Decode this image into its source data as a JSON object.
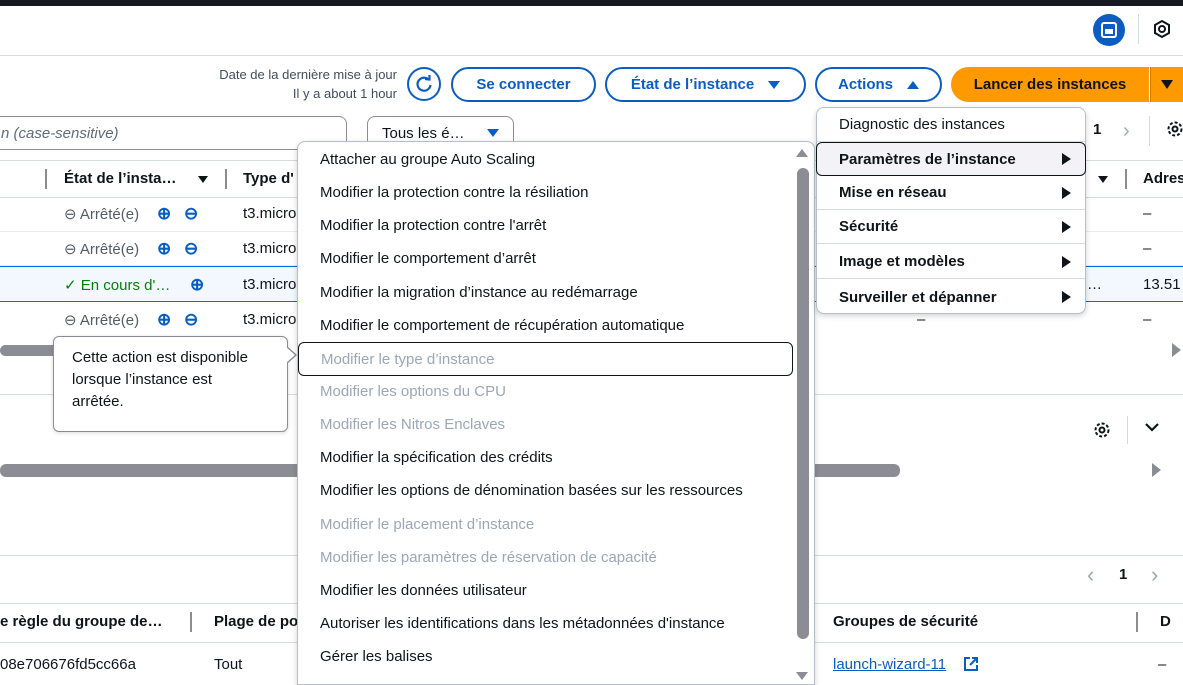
{
  "header": {
    "last_update_label": "Date de la dernière mise à jour",
    "last_update_value": "Il y a about 1 hour",
    "connect_button": "Se connecter",
    "instance_state_button": "État de l’instance",
    "actions_button": "Actions",
    "launch_button": "Lancer des instances"
  },
  "filter": {
    "search_placeholder_fragment": "n (case-sensitive)",
    "state_filter": "Tous les é…",
    "page_number": "1"
  },
  "table": {
    "headers": {
      "state": "État de l’insta…",
      "type": "Type d'",
      "address": "Adres"
    },
    "rows": [
      {
        "state": "Arrêté(e)",
        "type": "t3.micro",
        "address": "–",
        "extra": ""
      },
      {
        "state": "Arrêté(e)",
        "type": "t3.micro",
        "address": "–",
        "extra": ""
      },
      {
        "state": "En cours d'…",
        "type": "t3.micro",
        "address": "13.51",
        "extra": "…"
      },
      {
        "state": "Arrêté(e)",
        "type": "t3.micro",
        "address": "–",
        "extra": "–"
      }
    ]
  },
  "tooltip": {
    "text_line1": "Cette action est disponible",
    "text_line2": "lorsque l’instance est",
    "text_line3": "arrêtée."
  },
  "actions_menu": {
    "items": [
      {
        "label": "Diagnostic des instances",
        "submenu": false
      },
      {
        "label": "Paramètres de l’instance",
        "submenu": true
      },
      {
        "label": "Mise en réseau",
        "submenu": true
      },
      {
        "label": "Sécurité",
        "submenu": true
      },
      {
        "label": "Image et modèles",
        "submenu": true
      },
      {
        "label": "Surveiller et dépanner",
        "submenu": true
      }
    ]
  },
  "submenu": {
    "items": [
      {
        "label": "Attacher au groupe Auto Scaling",
        "disabled": false
      },
      {
        "label": "Modifier la protection contre la résiliation",
        "disabled": false
      },
      {
        "label": "Modifier la protection contre l'arrêt",
        "disabled": false
      },
      {
        "label": "Modifier le comportement d’arrêt",
        "disabled": false
      },
      {
        "label": "Modifier la migration d’instance au redémarrage",
        "disabled": false
      },
      {
        "label": "Modifier le comportement de récupération automatique",
        "disabled": false
      },
      {
        "label": "Modifier le type d’instance",
        "disabled": true
      },
      {
        "label": "Modifier les options du CPU",
        "disabled": true
      },
      {
        "label": "Modifier les Nitros Enclaves",
        "disabled": true
      },
      {
        "label": "Modifier la spécification des crédits",
        "disabled": false
      },
      {
        "label": "Modifier les options de dénomination basées sur les ressources",
        "disabled": false
      },
      {
        "label": "Modifier le placement d’instance",
        "disabled": true
      },
      {
        "label": "Modifier les paramètres de réservation de capacité",
        "disabled": true
      },
      {
        "label": "Modifier les données utilisateur",
        "disabled": false
      },
      {
        "label": "Autoriser les identifications dans les métadonnées d'instance",
        "disabled": false
      },
      {
        "label": "Gérer les balises",
        "disabled": false
      }
    ]
  },
  "lower_panel": {
    "page_number": "1",
    "headers": {
      "rule_id": "e règle du groupe de…",
      "port_range": "Plage de po",
      "security_groups": "Groupes de sécurité",
      "last_col": "D"
    },
    "row": {
      "rule_id": "08e706676fd5cc66a",
      "port_range": "Tout",
      "security_group": "launch-wizard-11",
      "last_col": "–"
    }
  },
  "colors": {
    "accent": "#0a5dc2",
    "launch": "#ff9900",
    "running": "#037f0c",
    "disabled": "#9ba7b6"
  }
}
